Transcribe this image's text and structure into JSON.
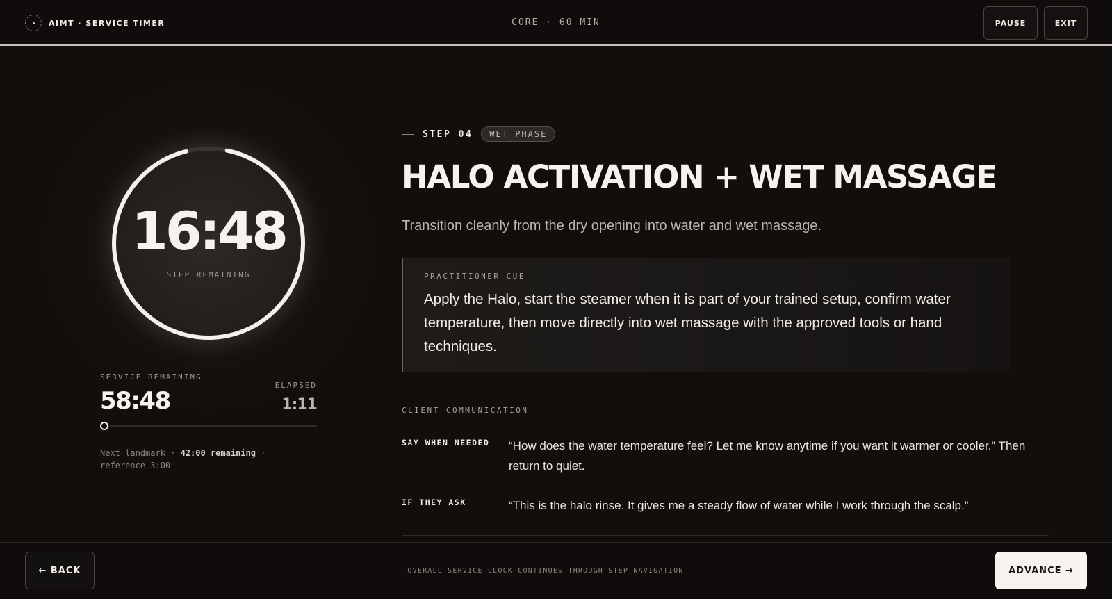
{
  "header": {
    "brand": "AIMT · SERVICE TIMER",
    "session": "CORE · 60 MIN",
    "pause_label": "PAUSE",
    "exit_label": "EXIT"
  },
  "timer": {
    "step_remaining": "16:48",
    "step_remaining_label": "STEP REMAINING",
    "step_progress_fraction": 0.93,
    "service_remaining_label": "SERVICE REMAINING",
    "service_remaining": "58:48",
    "elapsed_label": "ELAPSED",
    "elapsed": "1:11",
    "service_progress_fraction": 0.02,
    "landmark_prefix": "Next landmark · ",
    "landmark_value": "42:00 remaining",
    "landmark_suffix": " · reference 3:00"
  },
  "step": {
    "number": "STEP 04",
    "phase": "WET PHASE",
    "title": "HALO ACTIVATION + WET MASSAGE",
    "subtitle": "Transition cleanly from the dry opening into water and wet massage.",
    "cue_label": "PRACTITIONER CUE",
    "cue_text": "Apply the Halo, start the steamer when it is part of your trained setup, confirm water temperature, then move directly into wet massage with the approved tools or hand techniques."
  },
  "communication": {
    "label": "CLIENT COMMUNICATION",
    "items": [
      {
        "key": "SAY WHEN NEEDED",
        "text": "“How does the water temperature feel? Let me know anytime if you want it warmer or cooler.” Then return to quiet."
      },
      {
        "key": "IF THEY ASK",
        "text": "“This is the halo rinse. It gives me a steady flow of water while I work through the scalp.”"
      }
    ]
  },
  "footer": {
    "back_label": "← BACK",
    "note": "OVERALL SERVICE CLOCK CONTINUES THROUGH STEP NAVIGATION",
    "advance_label": "ADVANCE →"
  },
  "colors": {
    "background": "#110e0c",
    "text": "#f1ede8",
    "muted": "#9e9691",
    "ring": "#f4f0ec",
    "ring_track": "#3a3533",
    "header_rule": "#c9bfbb",
    "advance_bg": "#f7f4f0"
  }
}
